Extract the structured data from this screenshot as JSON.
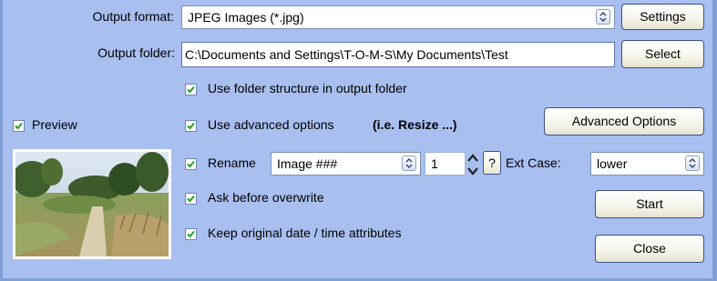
{
  "output_format": {
    "label": "Output format:",
    "value": "JPEG Images (*.jpg)",
    "settings_label": "Settings"
  },
  "output_folder": {
    "label": "Output folder:",
    "value": "C:\\Documents and Settings\\T-O-M-S\\My Documents\\Test",
    "select_label": "Select"
  },
  "options": {
    "folder_structure": {
      "label": "Use folder structure in output folder",
      "checked": true
    },
    "advanced": {
      "label": "Use advanced options",
      "hint": "(i.e. Resize ...)",
      "checked": true
    },
    "advanced_button": "Advanced Options",
    "rename": {
      "label": "Rename",
      "checked": true,
      "pattern": "Image ###",
      "start": "1",
      "help": "?"
    },
    "ext_case": {
      "label": "Ext Case:",
      "value": "lower"
    },
    "ask_overwrite": {
      "label": "Ask before overwrite",
      "checked": true
    },
    "keep_dates": {
      "label": "Keep original date / time attributes",
      "checked": true
    }
  },
  "preview": {
    "label": "Preview",
    "checked": true
  },
  "buttons": {
    "start": "Start",
    "close": "Close"
  },
  "colors": {
    "background": "#a9bff0",
    "border": "#7f9fd4",
    "checkmark": "#21a121"
  }
}
